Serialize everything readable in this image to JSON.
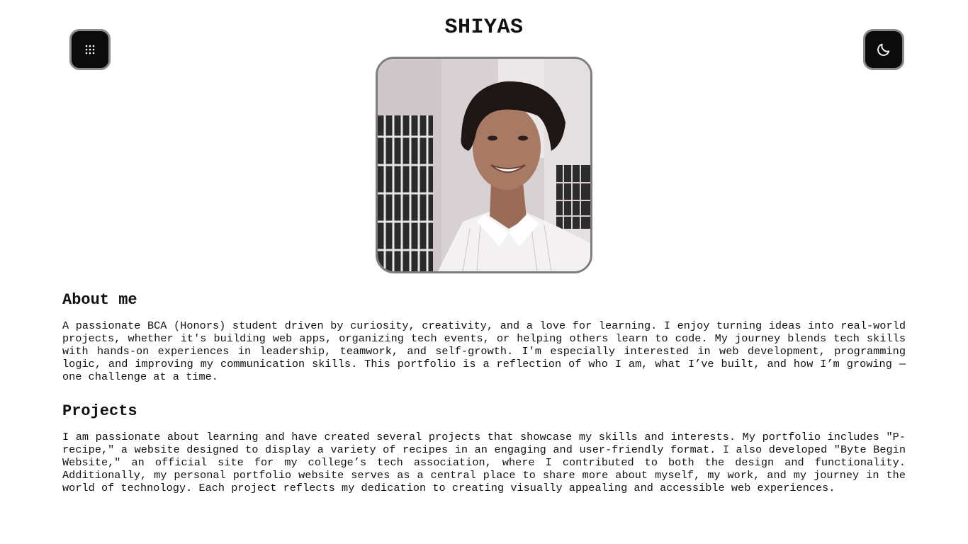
{
  "header": {
    "title": "SHIYAS",
    "menu_icon": "grid-dots-icon",
    "theme_icon": "moon-icon"
  },
  "profile": {
    "photo": "profile-photo"
  },
  "about": {
    "heading": "About me",
    "text": "A passionate BCA (Honors) student driven by curiosity, creativity, and a love for learning. I enjoy turning ideas into real-world projects, whether it's building web apps, organizing tech events, or helping others learn to code. My journey blends tech skills with hands-on experiences in leadership, teamwork, and self-growth. I'm especially interested in web development, programming logic, and improving my communication skills. This portfolio is a reflection of who I am, what I’ve built, and how I’m growing — one challenge at a time."
  },
  "projects": {
    "heading": "Projects",
    "text": "I am passionate about learning and have created several projects that showcase my skills and interests. My portfolio includes \"P-recipe,\" a website designed to display a variety of recipes in an engaging and user-friendly format. I also developed \"Byte Begin Website,\" an official site for my college’s tech association, where I contributed to both the design and functionality. Additionally, my personal portfolio website serves as a central place to share more about myself, my work, and my journey in the world of technology. Each project reflects my dedication to creating visually appealing and accessible web experiences."
  },
  "colors": {
    "button_bg": "#0b0b0b",
    "button_border": "#8a8a8a",
    "text": "#111111",
    "background": "#ffffff"
  }
}
